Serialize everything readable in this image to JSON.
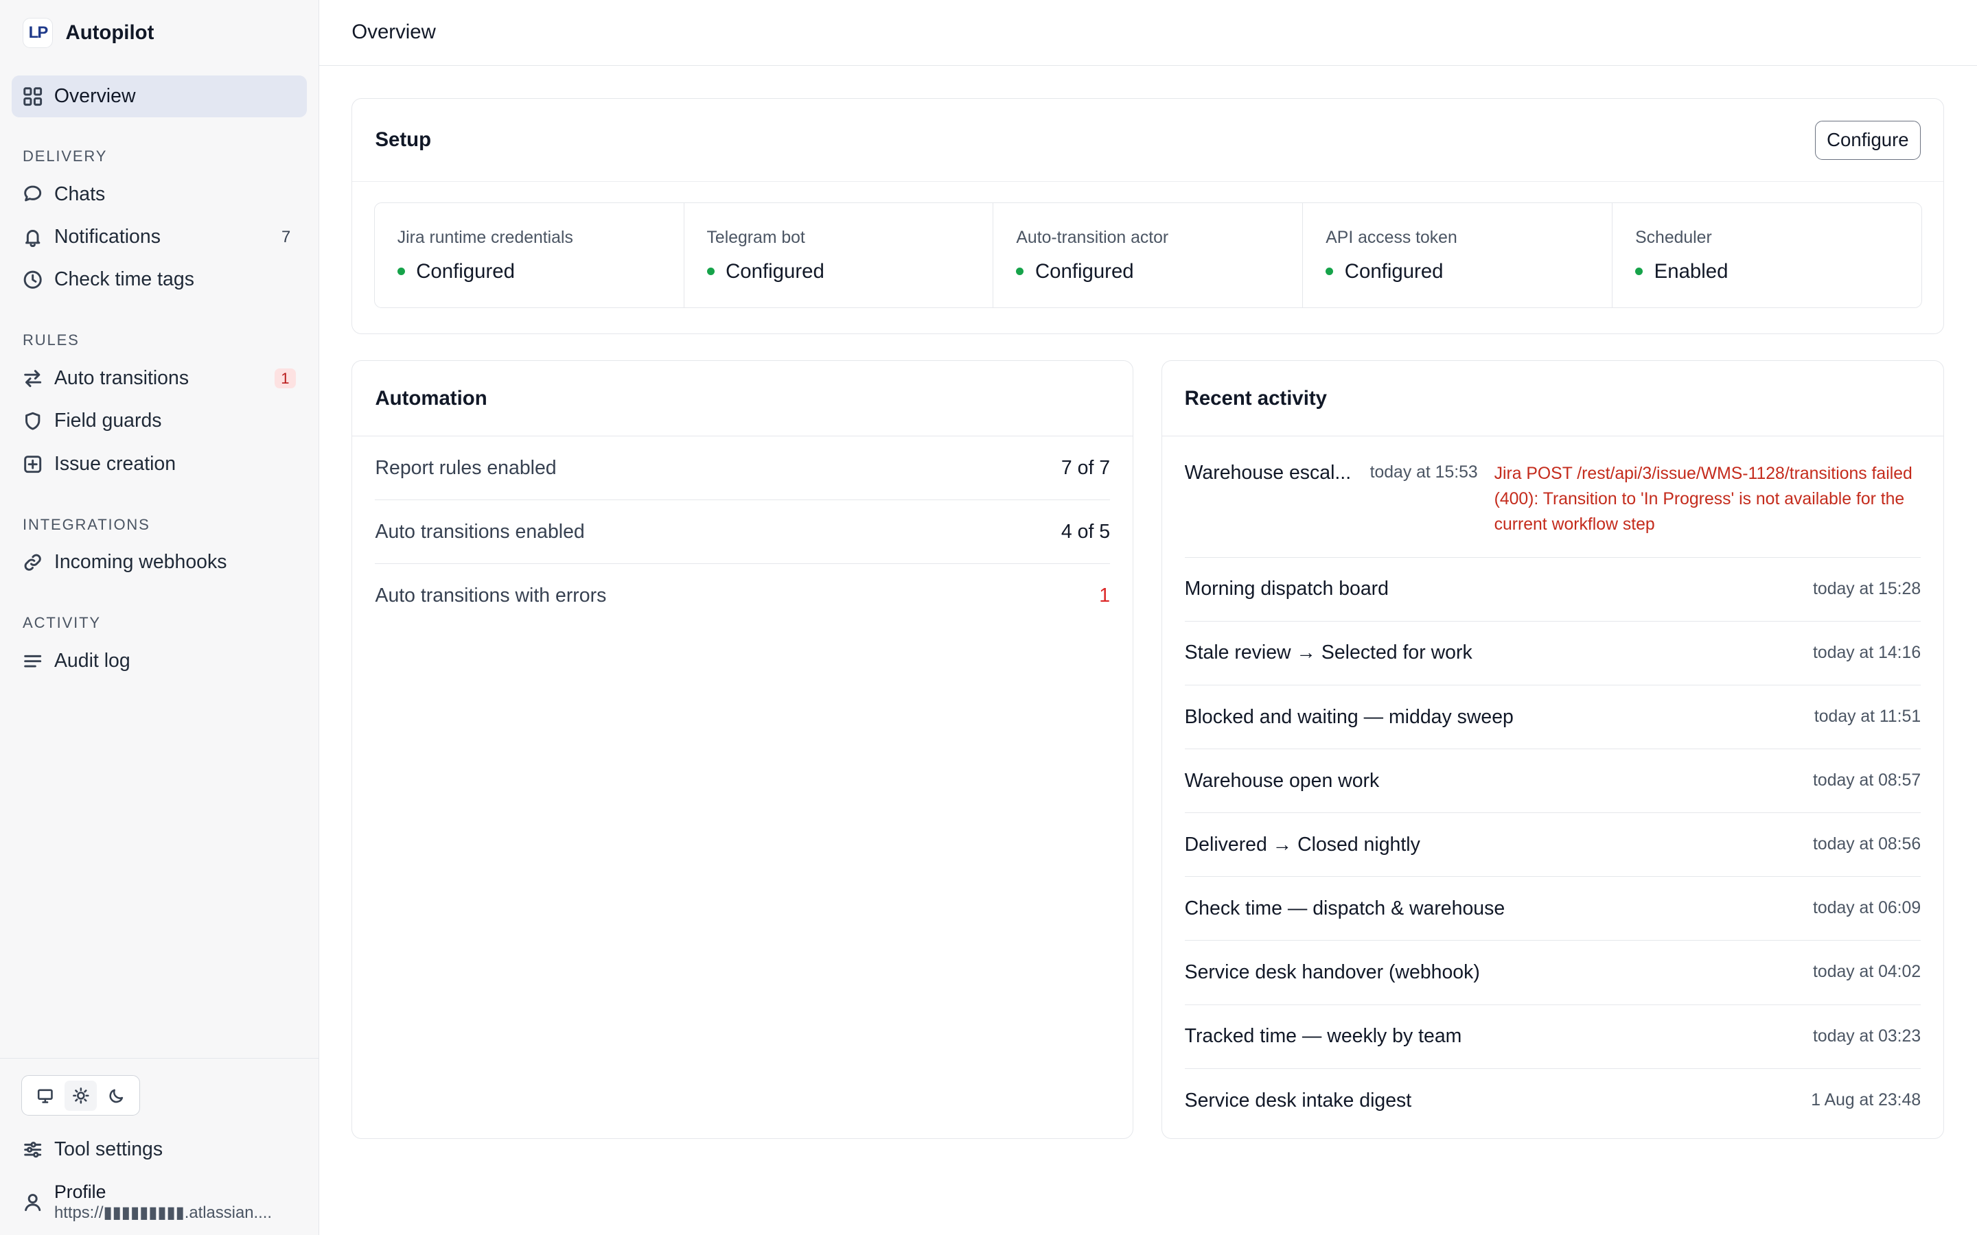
{
  "app": {
    "name": "Autopilot",
    "logo_text": "LP"
  },
  "sidebar": {
    "overview_label": "Overview",
    "sections": {
      "delivery": "DELIVERY",
      "rules": "RULES",
      "integrations": "INTEGRATIONS",
      "activity": "ACTIVITY"
    },
    "items": {
      "chats": "Chats",
      "notifications": "Notifications",
      "notifications_count": "7",
      "check_time_tags": "Check time tags",
      "auto_transitions": "Auto transitions",
      "auto_transitions_badge": "1",
      "field_guards": "Field guards",
      "issue_creation": "Issue creation",
      "incoming_webhooks": "Incoming webhooks",
      "audit_log": "Audit log",
      "tool_settings": "Tool settings"
    },
    "profile": {
      "name": "Profile",
      "url": "https://▮▮▮▮▮▮▮▮▮.atlassian...."
    },
    "theme": {
      "selected": "light",
      "options": [
        "system",
        "light",
        "dark"
      ]
    }
  },
  "header": {
    "title": "Overview"
  },
  "setup": {
    "title": "Setup",
    "configure_label": "Configure",
    "items": [
      {
        "label": "Jira runtime credentials",
        "value": "Configured"
      },
      {
        "label": "Telegram bot",
        "value": "Configured"
      },
      {
        "label": "Auto-transition actor",
        "value": "Configured"
      },
      {
        "label": "API access token",
        "value": "Configured"
      },
      {
        "label": "Scheduler",
        "value": "Enabled"
      }
    ],
    "status_color": "#16a34a"
  },
  "automation": {
    "title": "Automation",
    "rows": [
      {
        "label": "Report rules enabled",
        "value": "7 of 7"
      },
      {
        "label": "Auto transitions enabled",
        "value": "4 of 5"
      },
      {
        "label": "Auto transitions with errors",
        "value": "1"
      }
    ]
  },
  "activity": {
    "title": "Recent activity",
    "error_item": {
      "name": "Warehouse escal...",
      "time": "today at 15:53",
      "error": "Jira POST /rest/api/3/issue/WMS-1128/transitions failed (400): Transition to 'In Progress' is not available for the current workflow step"
    },
    "items": [
      {
        "name": "Morning dispatch board",
        "time": "today at 15:28"
      },
      {
        "name": "Stale review → Selected for work",
        "time": "today at 14:16"
      },
      {
        "name": "Blocked and waiting — midday sweep",
        "time": "today at 11:51"
      },
      {
        "name": "Warehouse open work",
        "time": "today at 08:57"
      },
      {
        "name": "Delivered → Closed nightly",
        "time": "today at 08:56"
      },
      {
        "name": "Check time — dispatch & warehouse",
        "time": "today at 06:09"
      },
      {
        "name": "Service desk handover (webhook)",
        "time": "today at 04:02"
      },
      {
        "name": "Tracked time — weekly by team",
        "time": "today at 03:23"
      },
      {
        "name": "Service desk intake digest",
        "time": "1 Aug at 23:48"
      }
    ]
  },
  "colors": {
    "accent": "#e3e7f2",
    "error": "#dc2626",
    "ok": "#16a34a"
  }
}
